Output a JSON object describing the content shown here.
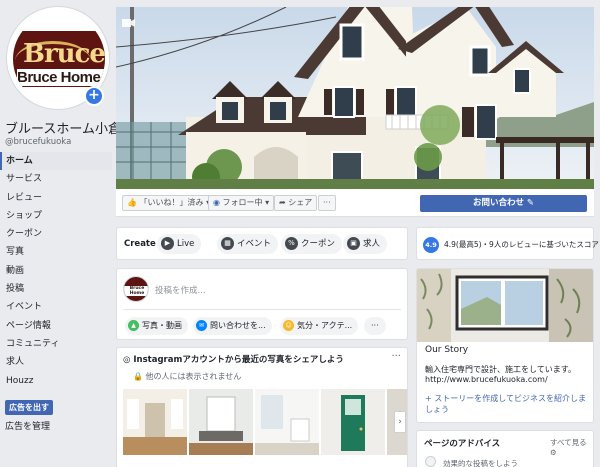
{
  "page": {
    "logo_line1": "Bruce",
    "logo_line2": "Bruce Home",
    "name": "ブルースホーム小倉",
    "handle": "@brucefukuoka"
  },
  "nav": {
    "items": [
      "ホーム",
      "サービス",
      "レビュー",
      "ショップ",
      "クーポン",
      "写真",
      "動画",
      "投稿",
      "イベント",
      "ページ情報",
      "コミュニティ",
      "求人",
      "Houzz"
    ],
    "promote_label": "広告を出す",
    "manage_ads_label": "広告を管理"
  },
  "actions": {
    "like_label": "「いいね！」済み",
    "follow_label": "フォロー中",
    "share_label": "シェア",
    "more_label": "···",
    "contact_label": "お問い合わせ"
  },
  "create": {
    "label": "Create",
    "items": [
      "Live",
      "イベント",
      "クーポン",
      "求人"
    ]
  },
  "composer": {
    "avatar_text": "Bruce Home",
    "placeholder": "投稿を作成...",
    "buttons": [
      "写真・動画",
      "問い合わせを...",
      "気分・アクテ..."
    ],
    "more_label": "···"
  },
  "instagram": {
    "title": "Instagramアカウントから最近の写真をシェアしよう",
    "subtitle": "他の人には表示されません",
    "more_label": "···",
    "next_label": "›"
  },
  "rating": {
    "score": "4.9",
    "text": "4.9(最高5)・9人のレビューに基づいたスコア"
  },
  "story": {
    "title": "Our Story",
    "body": "輸入住宅専門で設計、施工をしています。",
    "url": "http://www.brucefukuoka.com/",
    "add_label": "+ ストーリーを作成してビジネスを紹介しましょう"
  },
  "advice": {
    "title": "ページのアドバイス",
    "see_all": "すべて見る",
    "item": "効果的な投稿をしよう"
  },
  "colors": {
    "brand_blue": "#4267b2",
    "accent_blue": "#3578e5",
    "logo_maroon": "#5e1410",
    "page_bg": "#e9ebee"
  }
}
